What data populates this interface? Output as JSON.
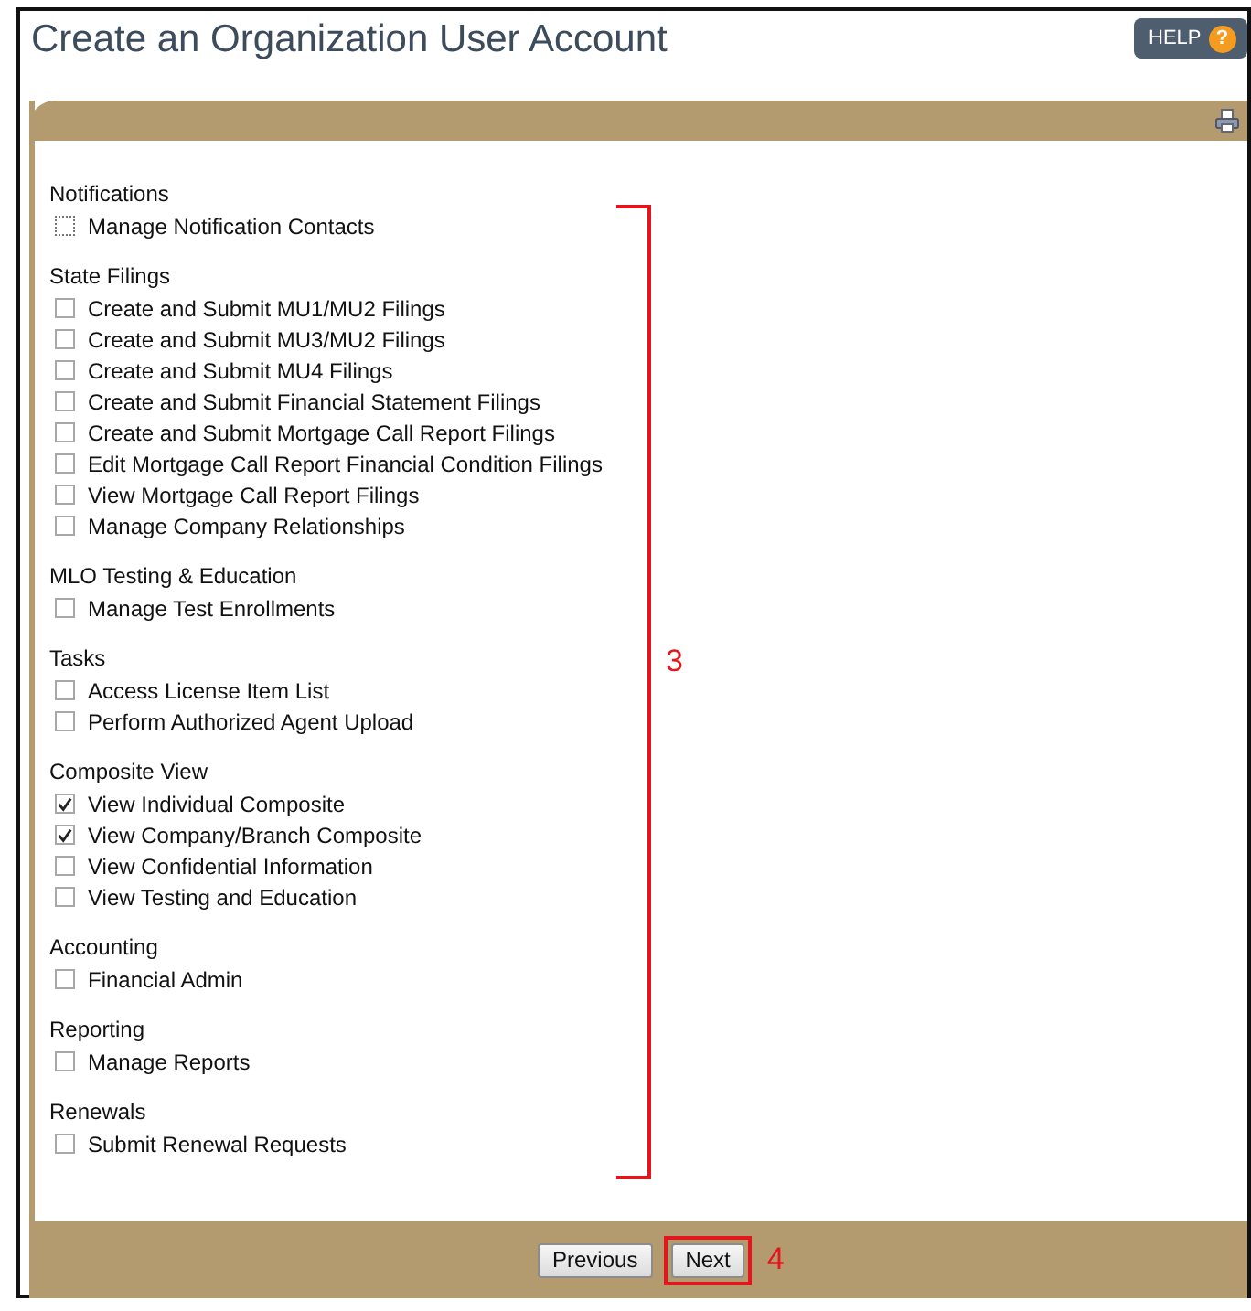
{
  "page": {
    "title": "Create an Organization User Account"
  },
  "help_button": {
    "label": "HELP",
    "symbol": "?"
  },
  "groups": [
    {
      "heading": "Notifications",
      "items": [
        {
          "label": "Manage Notification Contacts",
          "checked": false,
          "focused": true
        }
      ]
    },
    {
      "heading": "State Filings",
      "items": [
        {
          "label": "Create and Submit MU1/MU2 Filings",
          "checked": false,
          "focused": false
        },
        {
          "label": "Create and Submit MU3/MU2 Filings",
          "checked": false,
          "focused": false
        },
        {
          "label": "Create and Submit MU4 Filings",
          "checked": false,
          "focused": false
        },
        {
          "label": "Create and Submit Financial Statement Filings",
          "checked": false,
          "focused": false
        },
        {
          "label": "Create and Submit Mortgage Call Report Filings",
          "checked": false,
          "focused": false
        },
        {
          "label": "Edit Mortgage Call Report Financial Condition Filings",
          "checked": false,
          "focused": false
        },
        {
          "label": "View Mortgage Call Report Filings",
          "checked": false,
          "focused": false
        },
        {
          "label": "Manage Company Relationships",
          "checked": false,
          "focused": false
        }
      ]
    },
    {
      "heading": "MLO Testing & Education",
      "items": [
        {
          "label": "Manage Test Enrollments",
          "checked": false,
          "focused": false
        }
      ]
    },
    {
      "heading": "Tasks",
      "items": [
        {
          "label": "Access License Item List",
          "checked": false,
          "focused": false
        },
        {
          "label": "Perform Authorized Agent Upload",
          "checked": false,
          "focused": false
        }
      ]
    },
    {
      "heading": "Composite View",
      "items": [
        {
          "label": "View Individual Composite",
          "checked": true,
          "focused": false
        },
        {
          "label": "View Company/Branch Composite",
          "checked": true,
          "focused": false
        },
        {
          "label": "View Confidential Information",
          "checked": false,
          "focused": false
        },
        {
          "label": "View Testing and Education",
          "checked": false,
          "focused": false
        }
      ]
    },
    {
      "heading": "Accounting",
      "items": [
        {
          "label": "Financial Admin",
          "checked": false,
          "focused": false
        }
      ]
    },
    {
      "heading": "Reporting",
      "items": [
        {
          "label": "Manage Reports",
          "checked": false,
          "focused": false
        }
      ]
    },
    {
      "heading": "Renewals",
      "items": [
        {
          "label": "Submit Renewal Requests",
          "checked": false,
          "focused": false
        }
      ]
    }
  ],
  "footer_buttons": [
    {
      "label": "Previous",
      "highlighted": false
    },
    {
      "label": "Next",
      "highlighted": true
    }
  ],
  "annotations": [
    {
      "kind": "bracket",
      "label": "3"
    },
    {
      "kind": "button",
      "label": "4"
    }
  ]
}
